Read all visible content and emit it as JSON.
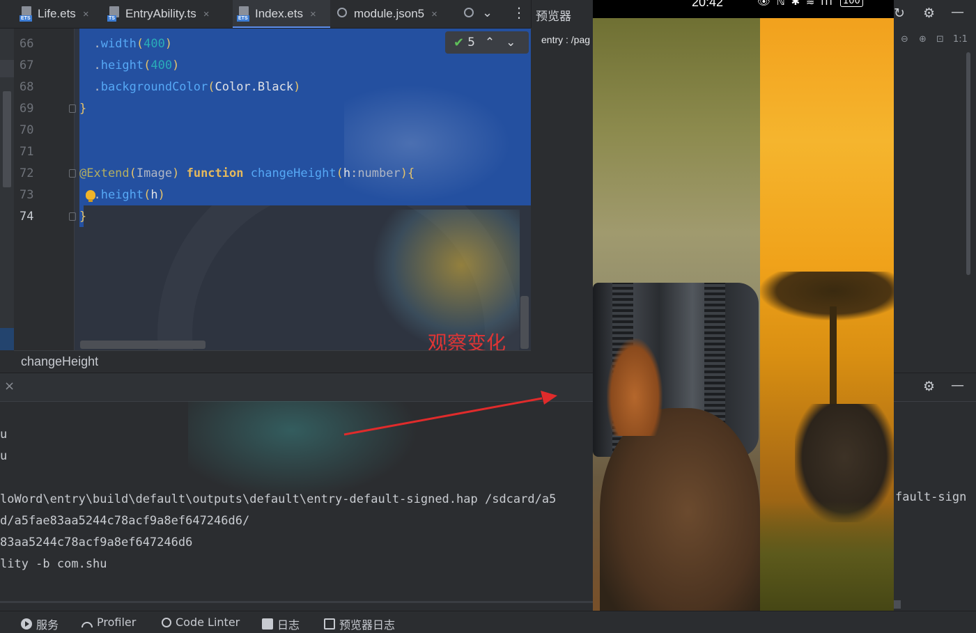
{
  "tabs": [
    {
      "label": "Life.ets",
      "badge": "ETS",
      "active": false
    },
    {
      "label": "EntryAbility.ts",
      "badge": "TS",
      "active": false
    },
    {
      "label": "Index.ets",
      "badge": "ETS",
      "active": true
    },
    {
      "label": "module.json5",
      "badge": "",
      "active": false
    }
  ],
  "tab_close": "×",
  "tab_more": "⌄",
  "tab_menu": "⋮",
  "editor": {
    "lines": [
      {
        "num": "66"
      },
      {
        "num": "67"
      },
      {
        "num": "68"
      },
      {
        "num": "69"
      },
      {
        "num": "70"
      },
      {
        "num": "71"
      },
      {
        "num": "72"
      },
      {
        "num": "73"
      },
      {
        "num": "74"
      }
    ],
    "code": {
      "l66_fn": "width",
      "l66_arg": "400",
      "l67_fn": "height",
      "l67_arg": "400",
      "l68_fn": "backgroundColor",
      "l68_arg": "Color.Black",
      "l69": "}",
      "l72_ann": "@Extend",
      "l72_type": "Image",
      "l72_kw": "function",
      "l72_fn": "changeHeight",
      "l72_param": "h",
      "l72_ptype": "number",
      "l73_fn": "height",
      "l73_arg": "h",
      "l74": "}"
    },
    "inspection_count": "5",
    "inspection_check": "✔",
    "inspection_up": "⌃",
    "inspection_down": "⌄"
  },
  "annotation_label": "观察变化",
  "breadcrumb": "changeHeight",
  "panel": {
    "close": "×",
    "output_lines": [
      "u",
      "u",
      "",
      "loWord\\entry\\build\\default\\outputs\\default\\entry-default-signed.hap /sdcard/a5",
      "d/a5fae83aa5244c78acf9a8ef647246d6/",
      "83aa5244c78acf9a8ef647246d6",
      "lity -b com.shu"
    ],
    "right_output": "fault-sign"
  },
  "statusbar": [
    {
      "label": "服务",
      "icon": "services-icon"
    },
    {
      "label": "Profiler",
      "icon": "profiler-icon"
    },
    {
      "label": "Code Linter",
      "icon": "code-linter-icon"
    },
    {
      "label": "日志",
      "icon": "log-icon"
    },
    {
      "label": "预览器日志",
      "icon": "previewer-log-icon"
    }
  ],
  "previewer": {
    "title": "预览器",
    "path": "entry : /pag"
  },
  "phone": {
    "time": "20:42",
    "status_icons": "👁 ℕ ✱ ≋ ıll",
    "battery": "100"
  },
  "right_column": {
    "gear": "⚙",
    "minimize": "—",
    "zoom_out": "⊖",
    "zoom_in": "⊕",
    "fit": "⊡",
    "ratio": "1:1"
  },
  "colors": {
    "selection": "#2450a0",
    "annotation": "#e03535",
    "accent": "#5b8ff0"
  }
}
